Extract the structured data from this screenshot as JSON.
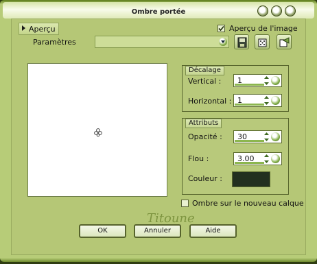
{
  "window": {
    "title": "Ombre portée"
  },
  "sidebar": {
    "tab_label": "Aperçu",
    "params_label": "Paramètres"
  },
  "preview_toggle": {
    "label": "Aperçu de l'image",
    "checked": true
  },
  "decalage": {
    "title": "Décalage",
    "vertical": {
      "label": "Vertical :",
      "value": "1"
    },
    "horizontal": {
      "label": "Horizontal :",
      "value": "1"
    }
  },
  "attributs": {
    "title": "Attributs",
    "opacite": {
      "label": "Opacité :",
      "value": "30"
    },
    "flou": {
      "label": "Flou :",
      "value": "3.00"
    },
    "couleur": {
      "label": "Couleur :",
      "color": "#22301f"
    }
  },
  "shadow_new_layer": {
    "label": "Ombre sur le nouveau calque",
    "checked": false
  },
  "watermark": {
    "text": "Titoune"
  },
  "buttons": {
    "ok": "OK",
    "cancel": "Annuler",
    "help": "Aide"
  },
  "icons": {
    "save": "save-icon",
    "delete": "delete-icon",
    "random": "dice-icon",
    "reset": "reset-icon"
  }
}
